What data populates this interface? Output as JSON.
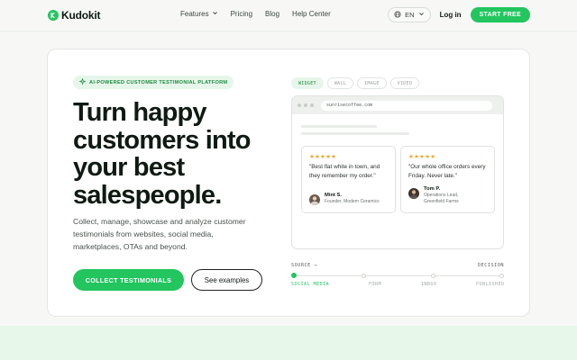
{
  "nav": {
    "brand": "Kudokit",
    "links": [
      {
        "label": "Features",
        "has_dropdown": true
      },
      {
        "label": "Pricing"
      },
      {
        "label": "Blog"
      },
      {
        "label": "Help Center"
      }
    ],
    "language": "EN",
    "login": "Log in",
    "cta": "START FREE"
  },
  "hero": {
    "badge": "AI-POWERED CUSTOMER TESTIMONIAL PLATFORM",
    "headline": "Turn happy customers into your best salespeople.",
    "subtext": "Collect, manage, showcase and analyze customer testimonials from websites, social media, marketplaces, OTAs and beyond.",
    "primary_button": "COLLECT TESTIMONIALS",
    "secondary_button": "See examples"
  },
  "preview": {
    "tabs": [
      "WIDGET",
      "WALL",
      "IMAGE",
      "VIDEO"
    ],
    "active_tab": "WIDGET",
    "url": "sunrisecoffee.com",
    "reviews": [
      {
        "stars": "★★★★★",
        "quote": "\"Best flat white in town, and they remember my order.\"",
        "name": "Mint S.",
        "role": "Founder, Modern Ceramics"
      },
      {
        "stars": "★★★★★",
        "quote": "\"Our whole office orders every Friday. Never late.\"",
        "name": "Tom P.",
        "role": "Operations Lead, Greenfield Farms"
      }
    ]
  },
  "pipeline": {
    "source_label": "SOURCE →",
    "decision_label": "DECISION",
    "steps": [
      "SOCIAL MEDIA",
      "FORM",
      "INBOX",
      "PUBLISHED"
    ],
    "active_step": "SOCIAL MEDIA"
  },
  "colors": {
    "accent": "#22c55e",
    "accent_soft": "#e6f6ea",
    "star": "#f5a524",
    "text": "#0f1a12"
  },
  "icons": [
    "kudokit-logo-icon",
    "chevron-down-icon",
    "globe-icon",
    "sparkle-icon",
    "arrow-right-icon"
  ]
}
